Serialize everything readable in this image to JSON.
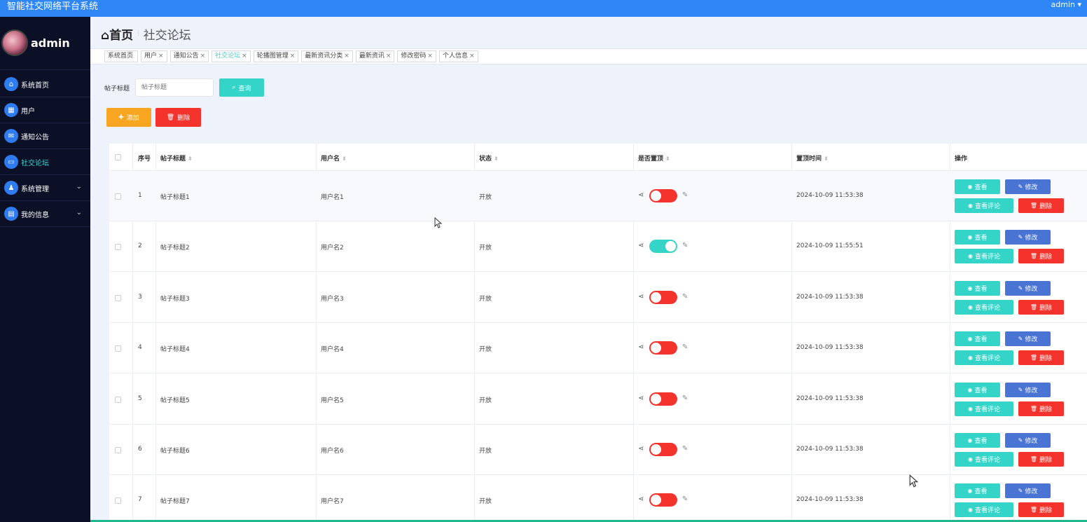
{
  "topbar": {
    "title": "智能社交网络平台系统",
    "user": "admin ▾"
  },
  "sidebar": {
    "admin_name": "admin",
    "items": [
      {
        "label": "系统首页",
        "icon": "home-icon",
        "glyph": "⌂",
        "active": false,
        "chevron": ""
      },
      {
        "label": "用户",
        "icon": "grid-icon",
        "glyph": "▦",
        "active": false,
        "chevron": ""
      },
      {
        "label": "通知公告",
        "icon": "mail-icon",
        "glyph": "✉",
        "active": false,
        "chevron": ""
      },
      {
        "label": "社交论坛",
        "icon": "chat-icon",
        "glyph": "▭",
        "active": true,
        "chevron": ""
      },
      {
        "label": "系统管理",
        "icon": "person-icon",
        "glyph": "♟",
        "active": false,
        "chevron": "⌄"
      },
      {
        "label": "我的信息",
        "icon": "card-icon",
        "glyph": "▤",
        "active": false,
        "chevron": "⌄"
      }
    ]
  },
  "breadcrumb": {
    "home": "⌂首页",
    "sep": "⫶",
    "current": "社交论坛"
  },
  "tabs": [
    {
      "label": "系统首页",
      "close": "",
      "active": false
    },
    {
      "label": "用户",
      "close": "×",
      "active": false
    },
    {
      "label": "通知公告",
      "close": "×",
      "active": false
    },
    {
      "label": "社交论坛",
      "close": "×",
      "active": true
    },
    {
      "label": "轮播图管理",
      "close": "×",
      "active": false
    },
    {
      "label": "最新资讯分类",
      "close": "×",
      "active": false
    },
    {
      "label": "最新资讯",
      "close": "×",
      "active": false
    },
    {
      "label": "修改密码",
      "close": "×",
      "active": false
    },
    {
      "label": "个人信息",
      "close": "×",
      "active": false
    }
  ],
  "search": {
    "label": "帖子标题",
    "placeholder": "帖子标题",
    "query_label": "查询"
  },
  "actions": {
    "add_label": "添加",
    "delete_label": "删除"
  },
  "table": {
    "headers": {
      "index": "序号",
      "title": "帖子标题",
      "username": "用户名",
      "status": "状态",
      "pinned": "是否置顶",
      "pin_time": "置顶时间",
      "ops": "操作"
    },
    "sort_glyph": "⬍",
    "buttons": {
      "view": "查看",
      "edit": "修改",
      "comment": "查看评论",
      "delete": "删除"
    },
    "rows": [
      {
        "index": "1",
        "title": "帖子标题1",
        "username": "用户名1",
        "status": "开放",
        "pinned": false,
        "pin_time": "2024-10-09 11:53:38"
      },
      {
        "index": "2",
        "title": "帖子标题2",
        "username": "用户名2",
        "status": "开放",
        "pinned": true,
        "pin_time": "2024-10-09 11:55:51"
      },
      {
        "index": "3",
        "title": "帖子标题3",
        "username": "用户名3",
        "status": "开放",
        "pinned": false,
        "pin_time": "2024-10-09 11:53:38"
      },
      {
        "index": "4",
        "title": "帖子标题4",
        "username": "用户名4",
        "status": "开放",
        "pinned": false,
        "pin_time": "2024-10-09 11:53:38"
      },
      {
        "index": "5",
        "title": "帖子标题5",
        "username": "用户名5",
        "status": "开放",
        "pinned": false,
        "pin_time": "2024-10-09 11:53:38"
      },
      {
        "index": "6",
        "title": "帖子标题6",
        "username": "用户名6",
        "status": "开放",
        "pinned": false,
        "pin_time": "2024-10-09 11:53:38"
      },
      {
        "index": "7",
        "title": "帖子标题7",
        "username": "用户名7",
        "status": "开放",
        "pinned": false,
        "pin_time": "2024-10-09 11:53:38"
      }
    ]
  },
  "colors": {
    "accent": "#35d4c8",
    "danger": "#f5332d",
    "primary": "#2f86f6",
    "edit": "#4a74d4",
    "warning": "#f8a622"
  }
}
